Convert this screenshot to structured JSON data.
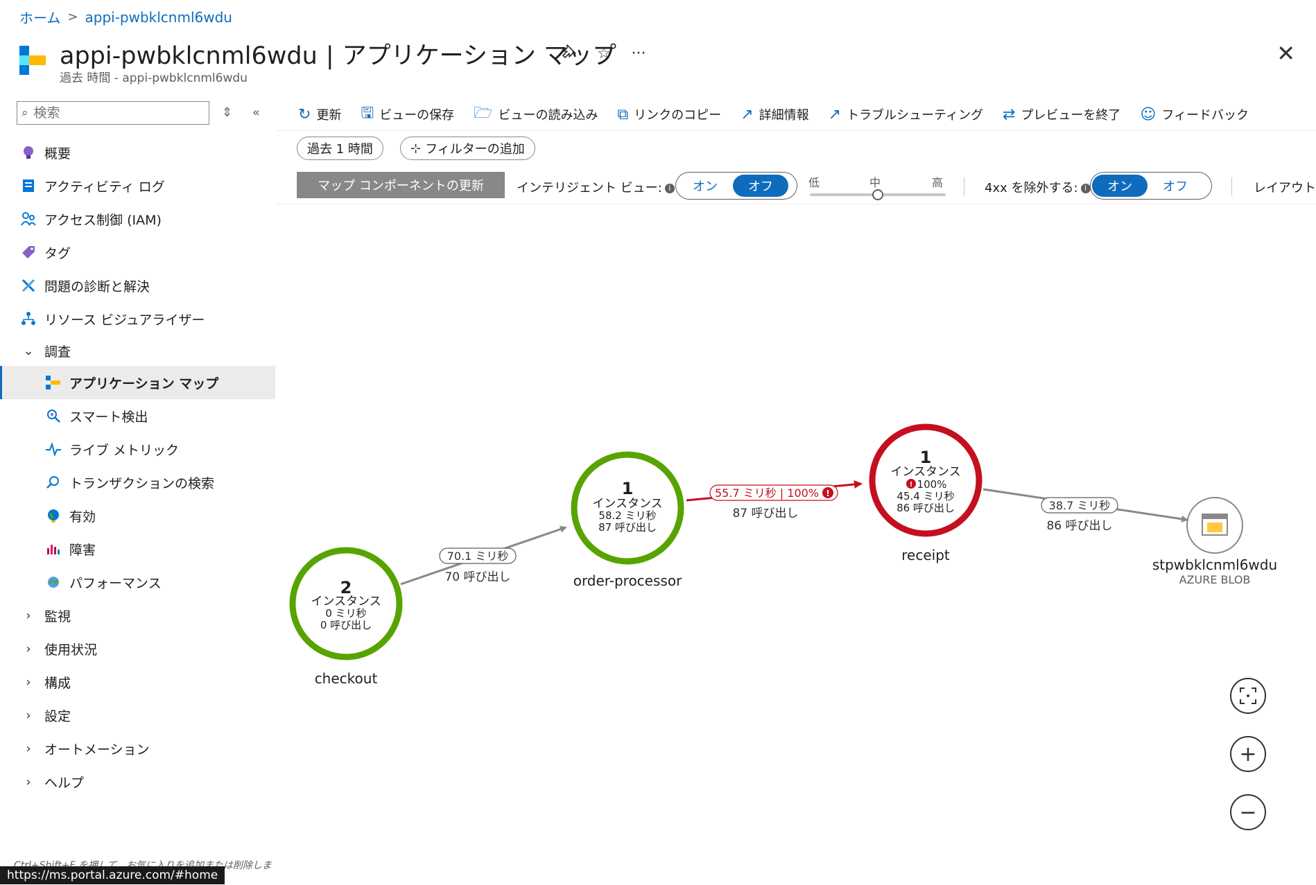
{
  "breadcrumb": {
    "home": "ホーム",
    "current": "appi-pwbklcnml6wdu"
  },
  "header": {
    "resource": "appi-pwbklcnml6wdu",
    "separator": "|",
    "page": "アプリケーション マップ",
    "subtitle": "過去 時間 - appi-pwbklcnml6wdu"
  },
  "sidebar": {
    "search_placeholder": "検索",
    "items": [
      {
        "label": "概要",
        "icon": "bulb-icon"
      },
      {
        "label": "アクティビティ ログ",
        "icon": "activity-log-icon"
      },
      {
        "label": "アクセス制御 (IAM)",
        "icon": "iam-icon"
      },
      {
        "label": "タグ",
        "icon": "tag-icon"
      },
      {
        "label": "問題の診断と解決",
        "icon": "wrench-icon"
      },
      {
        "label": "リソース ビジュアライザー",
        "icon": "visualizer-icon"
      }
    ],
    "group_investigate": "調査",
    "sub_items": [
      {
        "label": "アプリケーション マップ",
        "icon": "app-map-icon"
      },
      {
        "label": "スマート検出",
        "icon": "smart-detect-icon"
      },
      {
        "label": "ライブ メトリック",
        "icon": "live-metrics-icon"
      },
      {
        "label": "トランザクションの検索",
        "icon": "search-icon"
      },
      {
        "label": "有効",
        "icon": "globe-icon"
      },
      {
        "label": "障害",
        "icon": "failures-icon"
      },
      {
        "label": "パフォーマンス",
        "icon": "performance-icon"
      }
    ],
    "groups": [
      "監視",
      "使用状況",
      "構成",
      "設定",
      "オートメーション",
      "ヘルプ"
    ],
    "shortcut_hint": "Ctrl+Shift+F を押して、お気に入りを追加または削除しま",
    "status_url": "https://ms.portal.azure.com/#home"
  },
  "toolbar": {
    "refresh": "更新",
    "save_view": "ビューの保存",
    "load_view": "ビューの読み込み",
    "copy_link": "リンクのコピー",
    "details": "詳細情報",
    "troubleshoot": "トラブルシューティング",
    "exit_preview": "プレビューを終了",
    "feedback": "フィードバック"
  },
  "filters": {
    "time_range": "過去 1 時間",
    "add_filter": "フィルターの追加"
  },
  "controls": {
    "update_components": "マップ コンポーネントの更新",
    "intelligent_view_label": "インテリジェント ビュー:",
    "on": "オン",
    "off": "オフ",
    "intelligent_view_value": "off",
    "sensitivity_low": "低",
    "sensitivity_mid": "中",
    "sensitivity_high": "高",
    "sensitivity_value": "中",
    "exclude_4xx_label": "4xx を除外する:",
    "exclude_4xx_value": "on",
    "layout_label": "レイアウト"
  },
  "map": {
    "nodes": {
      "checkout": {
        "count": "2",
        "instances": "インスタンス",
        "duration": "0 ミリ秒",
        "calls": "0 呼び出し",
        "name": "checkout",
        "status_color": "#57a300"
      },
      "order_processor": {
        "count": "1",
        "instances": "インスタンス",
        "duration": "58.2 ミリ秒",
        "calls": "87 呼び出し",
        "name": "order-processor",
        "status_color": "#57a300"
      },
      "receipt": {
        "count": "1",
        "instances": "インスタンス",
        "error_rate": "100%",
        "duration": "45.4 ミリ秒",
        "calls": "86 呼び出し",
        "name": "receipt",
        "status_color": "#c50f1f"
      },
      "storage": {
        "name": "stpwbklcnml6wdu",
        "type": "AZURE BLOB",
        "icon": "blob-storage-icon"
      }
    },
    "edges": {
      "checkout_to_order": {
        "latency": "70.1 ミリ秒",
        "calls": "70 呼び出し"
      },
      "order_to_receipt": {
        "latency_error": "55.7 ミリ秒 | 100%",
        "calls": "87 呼び出し"
      },
      "receipt_to_storage": {
        "latency": "38.7 ミリ秒",
        "calls": "86 呼び出し"
      }
    }
  },
  "zoom": {
    "fit": "fit-icon",
    "in": "+",
    "out": "−"
  }
}
